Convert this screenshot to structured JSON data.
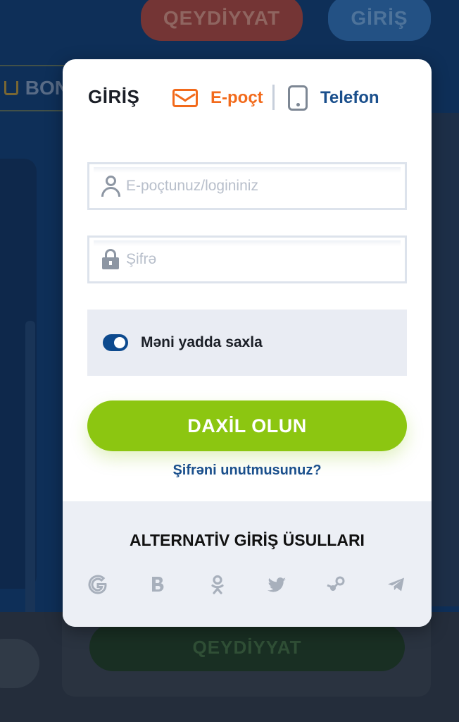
{
  "background": {
    "header_register": "QEYDİYYAT",
    "header_login": "GİRİŞ",
    "bonus_label": "BON",
    "footer_register": "QEYDİYYAT"
  },
  "modal": {
    "title": "GİRİŞ",
    "tabs": [
      {
        "label": "E-poçt",
        "icon": "envelope-icon",
        "active": true,
        "color": "#f26a1b"
      },
      {
        "label": "Telefon",
        "icon": "phone-icon",
        "active": false,
        "color": "#1a4f8c"
      }
    ],
    "login_field": {
      "value": "",
      "placeholder": "E-poçtunuz/logininiz",
      "icon": "user-icon"
    },
    "password_field": {
      "value": "",
      "placeholder": "Şifrə",
      "icon": "lock-icon"
    },
    "remember_me": {
      "label": "Məni yadda saxla",
      "checked": true
    },
    "submit_label": "DAXİL OLUN",
    "forgot_label": "Şifrəni unutmusunuz?",
    "alt_title": "ALTERNATİV GİRİŞ ÜSULLARI",
    "social": [
      "google-icon",
      "vk-icon",
      "odnoklassniki-icon",
      "twitter-icon",
      "steam-icon",
      "telegram-icon"
    ]
  },
  "colors": {
    "accent_orange": "#f26a1b",
    "primary_blue": "#0d4a8e",
    "submit_green": "#8cc611",
    "icon_gray": "#a8b0bc"
  }
}
